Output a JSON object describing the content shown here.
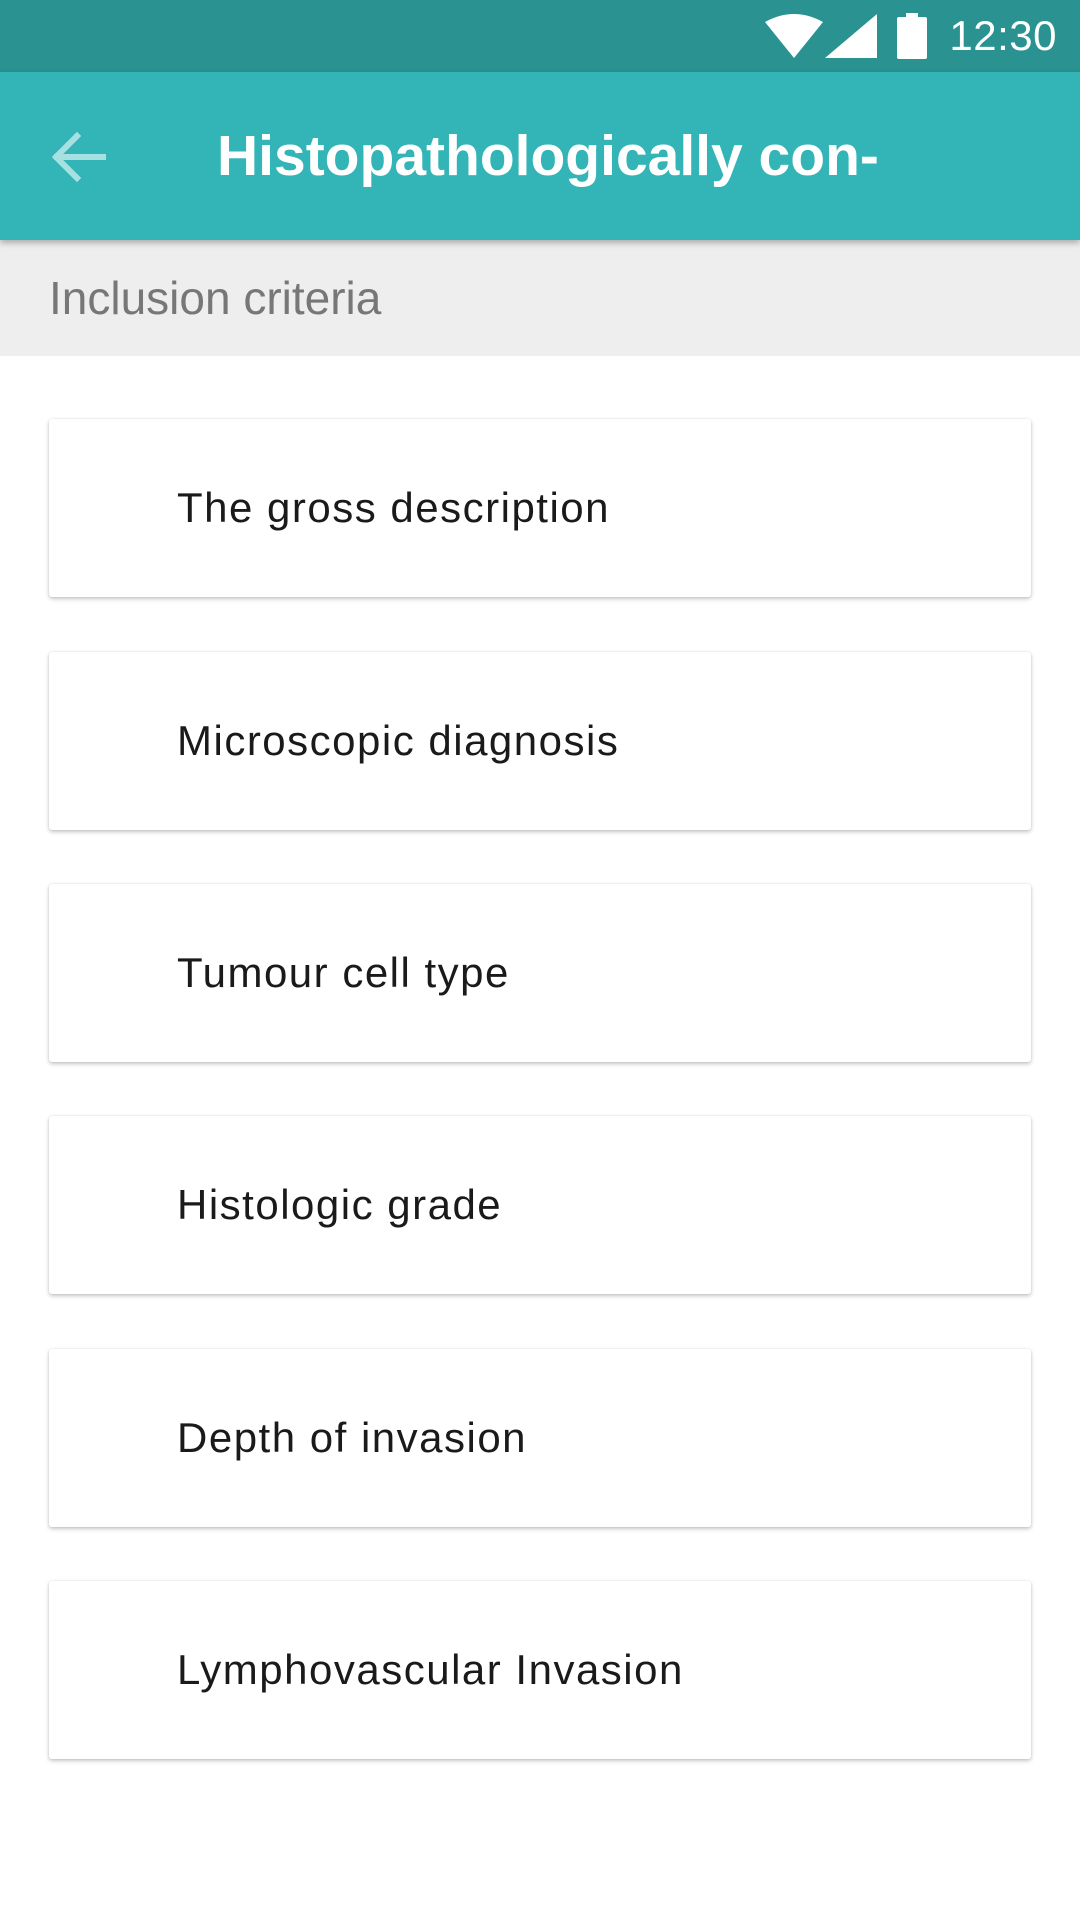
{
  "status_bar": {
    "time": "12:30",
    "icons": [
      "wifi-icon",
      "signal-icon",
      "battery-icon"
    ],
    "background": "#2a9291"
  },
  "app_bar": {
    "title": "Histopathologically con-",
    "back_icon": "arrow-back-icon",
    "background": "#33b4b6"
  },
  "section": {
    "title": "Inclusion criteria"
  },
  "cards": [
    {
      "label": "The gross description"
    },
    {
      "label": "Microscopic diagnosis"
    },
    {
      "label": "Tumour cell type"
    },
    {
      "label": "Histologic grade"
    },
    {
      "label": "Depth of invasion"
    },
    {
      "label": "Lymphovascular Invasion"
    }
  ]
}
